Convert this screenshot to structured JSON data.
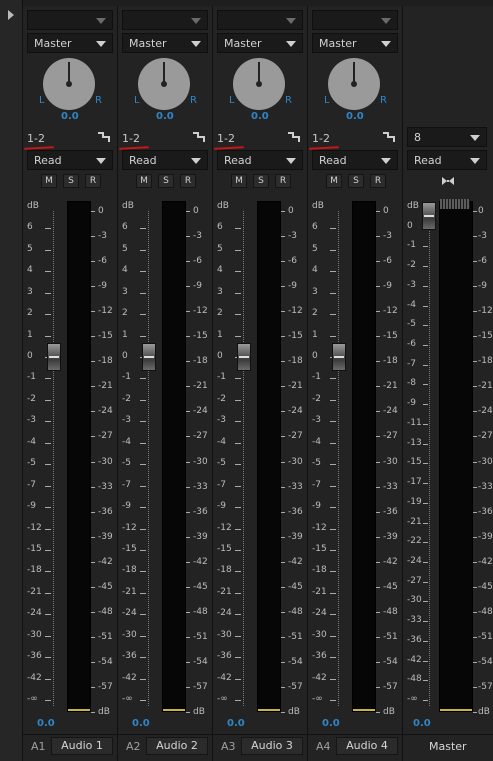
{
  "channels": [
    {
      "track_id": "A1",
      "name": "Audio 1",
      "send": "",
      "output": "Master",
      "pan_left": "L",
      "pan_right": "R",
      "pan_value": "0.0",
      "routing": "1-2",
      "automation": "Read",
      "buttons": [
        "M",
        "S",
        "R"
      ],
      "volume": "0.0"
    },
    {
      "track_id": "A2",
      "name": "Audio 2",
      "send": "",
      "output": "Master",
      "pan_left": "L",
      "pan_right": "R",
      "pan_value": "0.0",
      "routing": "1-2",
      "automation": "Read",
      "buttons": [
        "M",
        "S",
        "R"
      ],
      "volume": "0.0"
    },
    {
      "track_id": "A3",
      "name": "Audio 3",
      "send": "",
      "output": "Master",
      "pan_left": "L",
      "pan_right": "R",
      "pan_value": "0.0",
      "routing": "1-2",
      "automation": "Read",
      "buttons": [
        "M",
        "S",
        "R"
      ],
      "volume": "0.0"
    },
    {
      "track_id": "A4",
      "name": "Audio 4",
      "send": "",
      "output": "Master",
      "pan_left": "L",
      "pan_right": "R",
      "pan_value": "0.0",
      "routing": "1-2",
      "automation": "Read",
      "buttons": [
        "M",
        "S",
        "R"
      ],
      "volume": "0.0"
    }
  ],
  "master": {
    "name": "Master",
    "channels_count": "8",
    "automation": "Read",
    "volume": "0.0"
  },
  "fader_scale": [
    "dB",
    "6",
    "5",
    "4",
    "3",
    "2",
    "1",
    "0",
    "-1",
    "-2",
    "-3",
    "-4",
    "-5",
    "-7",
    "-9",
    "-12",
    "-15",
    "-18",
    "-21",
    "-24",
    "-30",
    "-36",
    "-42",
    "-∞"
  ],
  "meter_scale": [
    "0",
    "-3",
    "-6",
    "-9",
    "-12",
    "-15",
    "-18",
    "-21",
    "-24",
    "-27",
    "-30",
    "-33",
    "-36",
    "-39",
    "-42",
    "-45",
    "-48",
    "-51",
    "-54",
    "-57",
    "dB"
  ],
  "master_fader_scale": [
    "dB",
    "0",
    "-1",
    "-2",
    "-3",
    "-4",
    "-5",
    "-6",
    "-7",
    "-8",
    "-9",
    "-11",
    "-13",
    "-15",
    "-17",
    "-19",
    "-21",
    "-22",
    "-24",
    "-27",
    "-30",
    "-33",
    "-36",
    "-42",
    "-48",
    "-∞"
  ],
  "master_meter_scale": [
    "0",
    "-3",
    "-6",
    "-9",
    "-12",
    "-15",
    "-18",
    "-21",
    "-24",
    "-27",
    "-30",
    "-33",
    "-36",
    "-39",
    "-42",
    "-45",
    "-48",
    "-51",
    "-54",
    "-57",
    "dB"
  ],
  "colors": {
    "accent": "#2f86c6",
    "annotation": "#c41818",
    "meter_peak": "#c9b44a"
  }
}
